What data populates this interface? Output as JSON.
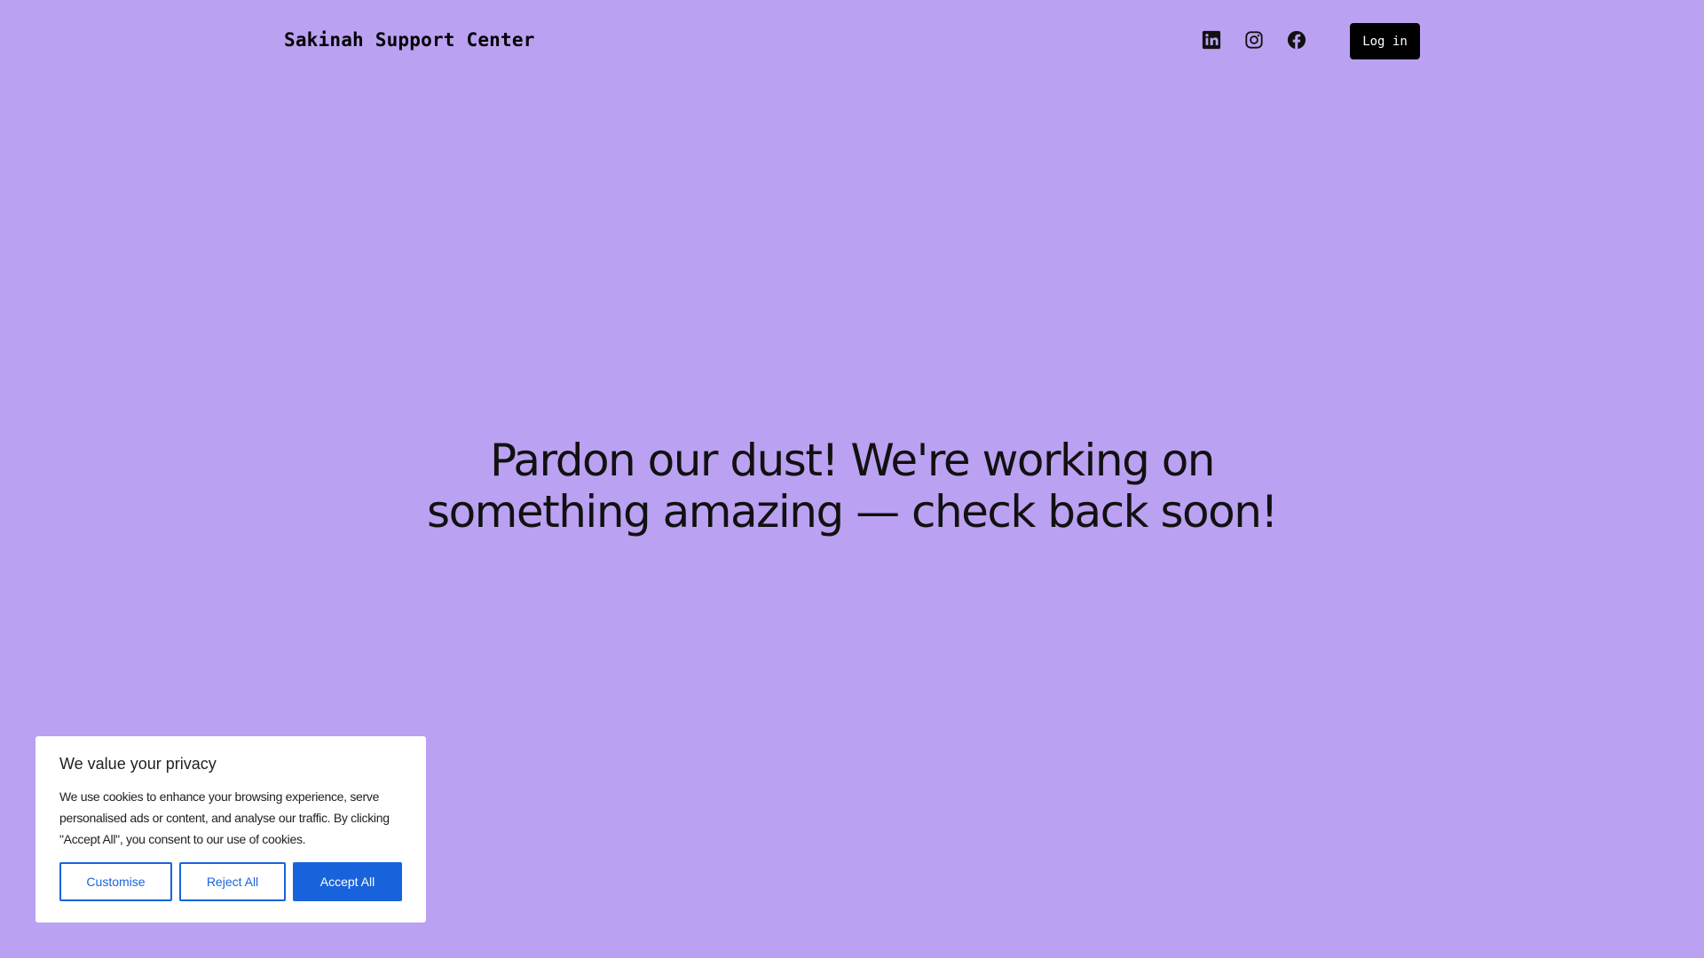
{
  "header": {
    "site_title": "Sakinah Support Center",
    "social_icons": [
      "linkedin-icon",
      "instagram-icon",
      "facebook-icon"
    ],
    "login_label": "Log in"
  },
  "hero": {
    "message_line1": "Pardon our dust! We're working on",
    "message_line2": "something amazing — check back soon!"
  },
  "cookie_banner": {
    "title": "We value your privacy",
    "text": "We use cookies to enhance your browsing experience, serve personalised ads or content, and analyse our traffic. By clicking \"Accept All\", you consent to our use of cookies.",
    "customise_label": "Customise",
    "reject_label": "Reject All",
    "accept_label": "Accept All"
  },
  "colors": {
    "background": "#bba1f1",
    "button_dark": "#000000",
    "accent_blue": "#1863dc"
  }
}
